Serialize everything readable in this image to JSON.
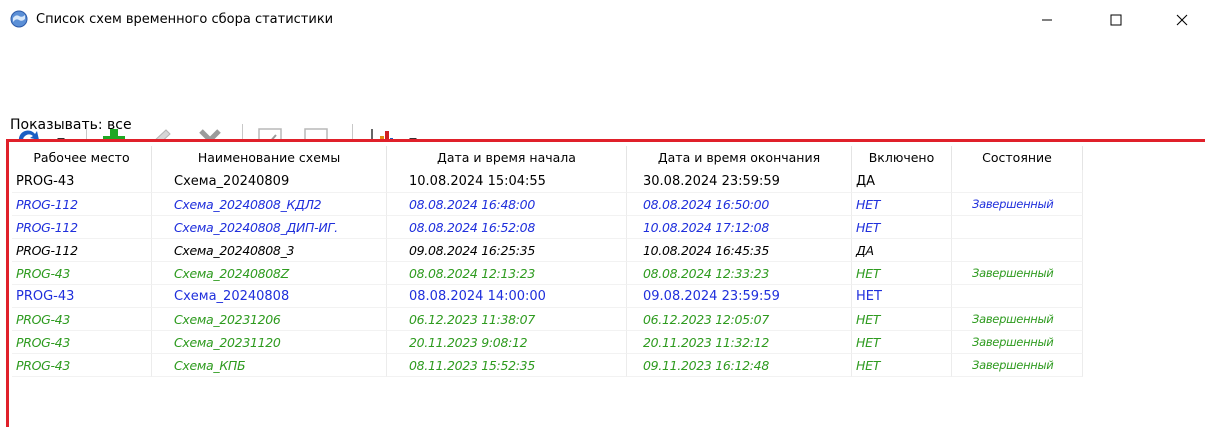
{
  "window": {
    "title": "Список схем временного сбора статистики",
    "controls": [
      "minimize",
      "maximize",
      "close"
    ]
  },
  "toolbar": {
    "items": [
      {
        "name": "refresh",
        "icon": "refresh-arrows-icon",
        "dropdown": true,
        "enabled": true
      },
      {
        "name": "add",
        "icon": "green-plus-icon",
        "enabled": true
      },
      {
        "name": "edit",
        "icon": "pencil-icon",
        "enabled": false
      },
      {
        "name": "delete",
        "icon": "x-icon",
        "enabled": false
      },
      {
        "name": "enable",
        "icon": "checkbox-checked-icon",
        "enabled": false
      },
      {
        "name": "disable",
        "icon": "checkbox-empty-icon",
        "enabled": false
      },
      {
        "name": "statistics",
        "icon": "bar-chart-icon",
        "dropdown": true,
        "enabled": true
      }
    ]
  },
  "filter": {
    "label": "Показывать: все"
  },
  "table": {
    "columns": [
      "Рабочее место",
      "Наименование схемы",
      "Дата и время начала",
      "Дата и время окончания",
      "Включено",
      "Состояние"
    ],
    "rows": [
      {
        "workplace": "PROG-43",
        "scheme": "Схема_20240809",
        "start": "10.08.2024 15:04:55",
        "end": "30.08.2024 23:59:59",
        "enabled": "ДА",
        "state": "",
        "color": "#000000",
        "italic": false
      },
      {
        "workplace": "PROG-112",
        "scheme": "Схема_20240808_КДЛ2",
        "start": "08.08.2024 16:48:00",
        "end": "08.08.2024 16:50:00",
        "enabled": "НЕТ",
        "state": "Завершенный",
        "color": "#1f2fdc",
        "italic": true
      },
      {
        "workplace": "PROG-112",
        "scheme": "Схема_20240808_ДИП-ИГ.",
        "start": "08.08.2024 16:52:08",
        "end": "10.08.2024 17:12:08",
        "enabled": "НЕТ",
        "state": "",
        "color": "#1f2fdc",
        "italic": true
      },
      {
        "workplace": "PROG-112",
        "scheme": "Схема_20240808_3",
        "start": "09.08.2024 16:25:35",
        "end": "10.08.2024 16:45:35",
        "enabled": "ДА",
        "state": "",
        "color": "#000000",
        "italic": true
      },
      {
        "workplace": "PROG-43",
        "scheme": "Схема_20240808Z",
        "start": "08.08.2024 12:13:23",
        "end": "08.08.2024 12:33:23",
        "enabled": "НЕТ",
        "state": "Завершенный",
        "color": "#2e9b1f",
        "italic": true
      },
      {
        "workplace": "PROG-43",
        "scheme": "Схема_20240808",
        "start": "08.08.2024 14:00:00",
        "end": "09.08.2024 23:59:59",
        "enabled": "НЕТ",
        "state": "",
        "color": "#1f2fdc",
        "italic": false
      },
      {
        "workplace": "PROG-43",
        "scheme": "Схема_20231206",
        "start": "06.12.2023 11:38:07",
        "end": "06.12.2023 12:05:07",
        "enabled": "НЕТ",
        "state": "Завершенный",
        "color": "#2e9b1f",
        "italic": true
      },
      {
        "workplace": "PROG-43",
        "scheme": "Схема_20231120",
        "start": "20.11.2023 9:08:12",
        "end": "20.11.2023 11:32:12",
        "enabled": "НЕТ",
        "state": "Завершенный",
        "color": "#2e9b1f",
        "italic": true
      },
      {
        "workplace": "PROG-43",
        "scheme": "Схема_КПБ",
        "start": "08.11.2023 15:52:35",
        "end": "09.11.2023 16:12:48",
        "enabled": "НЕТ",
        "state": "Завершенный",
        "color": "#2e9b1f",
        "italic": true
      }
    ]
  },
  "colors": {
    "accent_border": "#e0202a",
    "blue_text": "#1f2fdc",
    "green_text": "#2e9b1f"
  }
}
